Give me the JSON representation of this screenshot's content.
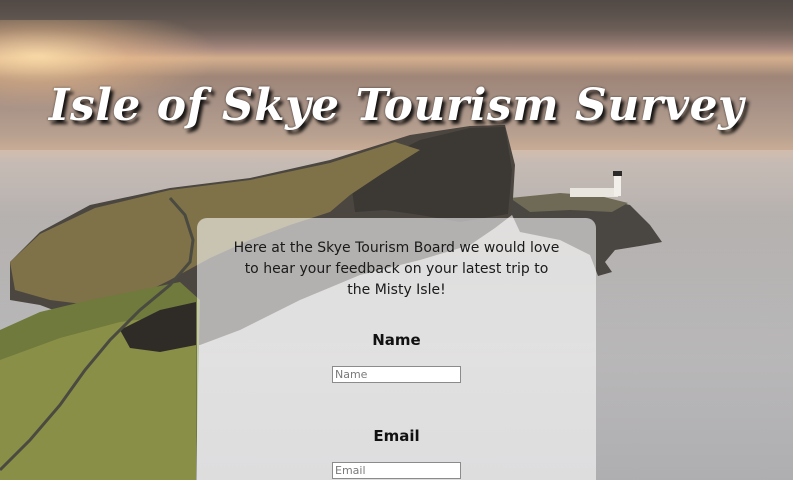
{
  "page": {
    "title": "Isle of Skye Tourism Survey",
    "intro": "Here at the Skye Tourism Board we would love to hear your feedback on your latest trip to the Misty Isle!"
  },
  "form": {
    "name": {
      "label": "Name",
      "placeholder": "Name",
      "value": ""
    },
    "email": {
      "label": "Email",
      "placeholder": "Email",
      "value": ""
    }
  },
  "background": {
    "icon": "coastal-cliff-lighthouse-image"
  }
}
